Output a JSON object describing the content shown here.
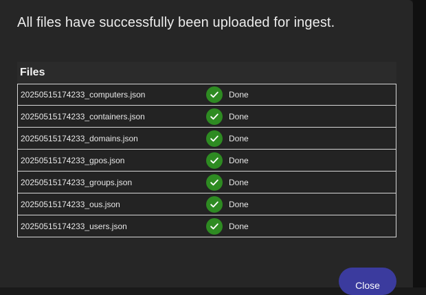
{
  "dialog": {
    "title": "All files have successfully been uploaded for ingest.",
    "files_header": "Files",
    "close_label": "Close"
  },
  "files": [
    {
      "name": "20250515174233_computers.json",
      "status": "Done"
    },
    {
      "name": "20250515174233_containers.json",
      "status": "Done"
    },
    {
      "name": "20250515174233_domains.json",
      "status": "Done"
    },
    {
      "name": "20250515174233_gpos.json",
      "status": "Done"
    },
    {
      "name": "20250515174233_groups.json",
      "status": "Done"
    },
    {
      "name": "20250515174233_ous.json",
      "status": "Done"
    },
    {
      "name": "20250515174233_users.json",
      "status": "Done"
    }
  ],
  "icons": {
    "status": "check-circle-icon"
  },
  "colors": {
    "success": "#2e8b22",
    "primary_button": "#3b3b9e",
    "dialog_bg": "#262626"
  }
}
